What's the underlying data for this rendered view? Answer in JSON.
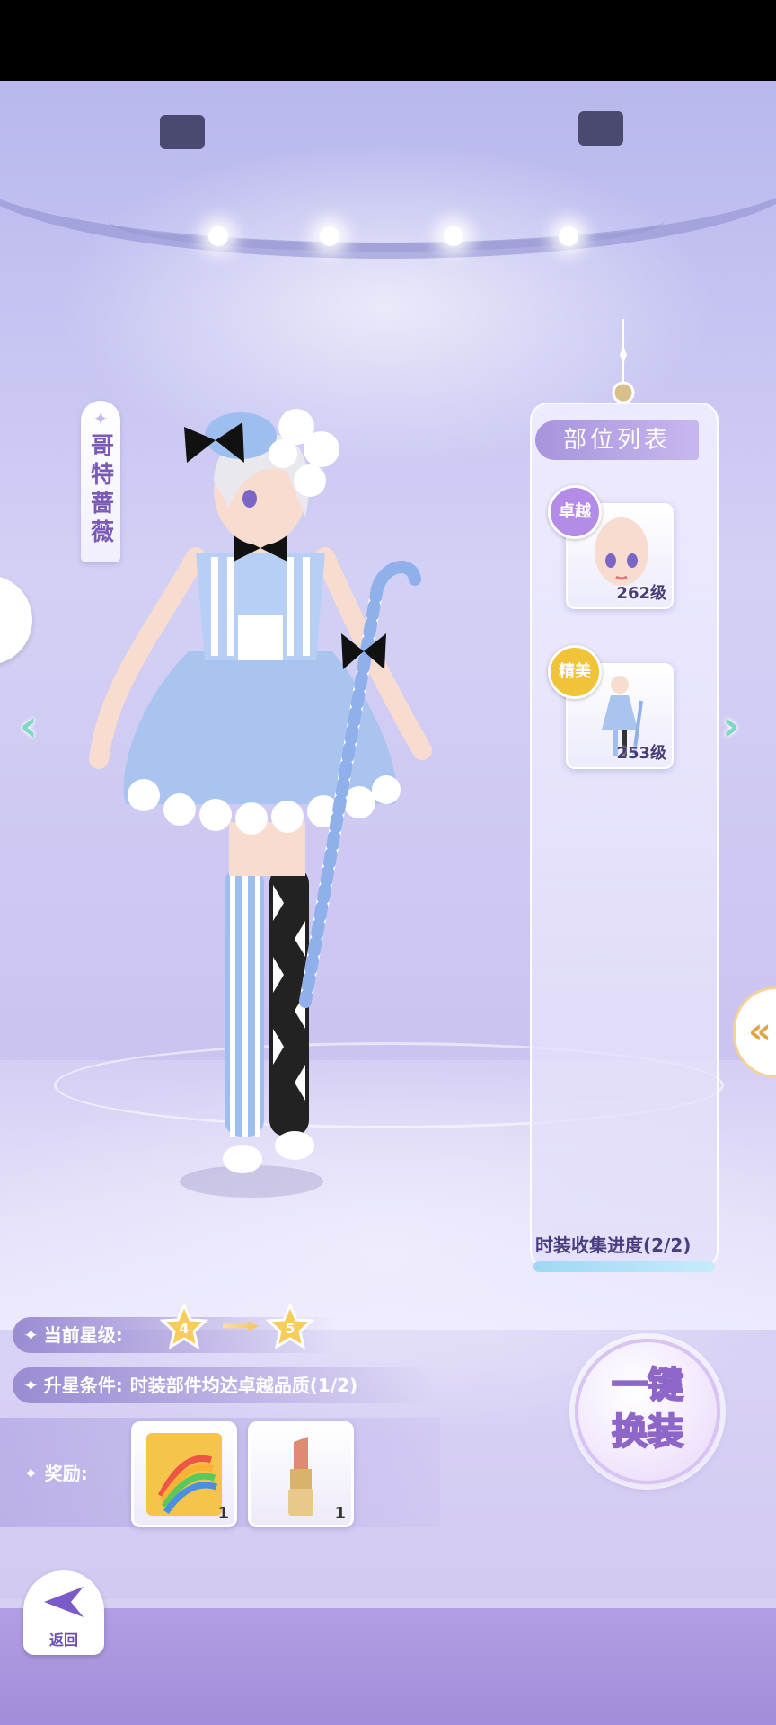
{
  "character": {
    "name": "哥特蔷薇"
  },
  "parts_panel": {
    "title": "部位列表",
    "items": [
      {
        "badge": "卓越",
        "badge_color": "#b48be6",
        "level": "262级",
        "icon": "face-icon"
      },
      {
        "badge": "精美",
        "badge_color": "#f0c338",
        "level": "253级",
        "icon": "outfit-figure-icon"
      }
    ],
    "progress_label": "时装收集进度(2/2)",
    "progress": 1.0
  },
  "star_info": {
    "current_label": "当前星级:",
    "from_star": "4",
    "to_star": "5",
    "condition_label": "升星条件:",
    "condition_text": "时装部件均达卓越品质(1/2)"
  },
  "rewards": {
    "label": "奖励:",
    "items": [
      {
        "icon": "rainbow-notebook-icon",
        "count": "1"
      },
      {
        "icon": "lipstick-icon",
        "count": "1"
      }
    ]
  },
  "outfit_button": {
    "line1": "一键",
    "line2": "换装"
  },
  "back_button": {
    "label": "返回"
  },
  "colors": {
    "accent": "#a794dc",
    "star": "#f3c361",
    "arrow": "#7fd7c8"
  }
}
